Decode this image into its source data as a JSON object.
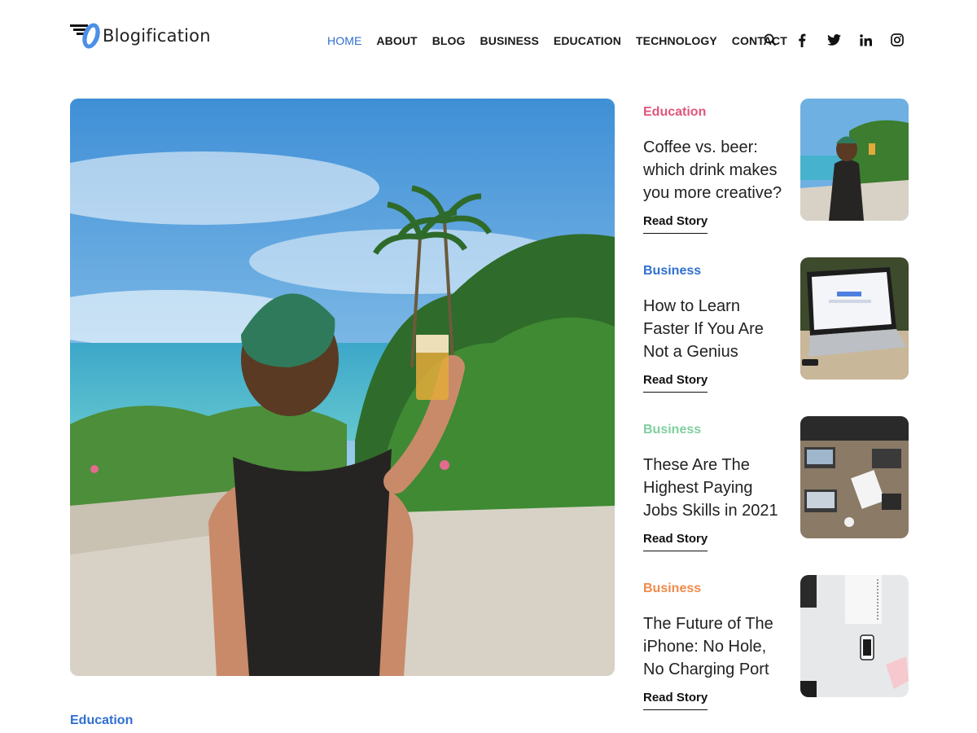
{
  "brand": {
    "name": "Blogification"
  },
  "nav": {
    "items": [
      {
        "label": "HOME"
      },
      {
        "label": "ABOUT"
      },
      {
        "label": "BLOG"
      },
      {
        "label": "BUSINESS"
      },
      {
        "label": "EDUCATION"
      },
      {
        "label": "TECHNOLOGY"
      },
      {
        "label": "CONTACT"
      }
    ],
    "active_color": "#2f6fd0"
  },
  "header_icons": [
    "search-icon",
    "facebook-icon",
    "twitter-icon",
    "linkedin-icon",
    "instagram-icon"
  ],
  "hero": {
    "category": "Education",
    "image": "man-toasting-beer-at-tropical-beach"
  },
  "posts": [
    {
      "category": "Education",
      "category_color": "#e2557d",
      "title": "Coffee vs. beer: which drink makes you more creative?",
      "read_label": "Read Story",
      "thumb": "man-toasting-beer-at-tropical-beach"
    },
    {
      "category": "Business",
      "category_color": "#2f6fd0",
      "title": "How to Learn Faster If You Are Not a Genius",
      "read_label": "Read Story",
      "thumb": "laptop-with-search-page"
    },
    {
      "category": "Business",
      "category_color": "#7fcf9e",
      "title": "These Are The Highest Paying Jobs Skills in 2021",
      "read_label": "Read Story",
      "thumb": "team-meeting-laptops-table"
    },
    {
      "category": "Business",
      "category_color": "#f08a4b",
      "title": "The Future of The iPhone: No Hole, No Charging Port",
      "read_label": "Read Story",
      "thumb": "phone-on-white-desk"
    }
  ]
}
